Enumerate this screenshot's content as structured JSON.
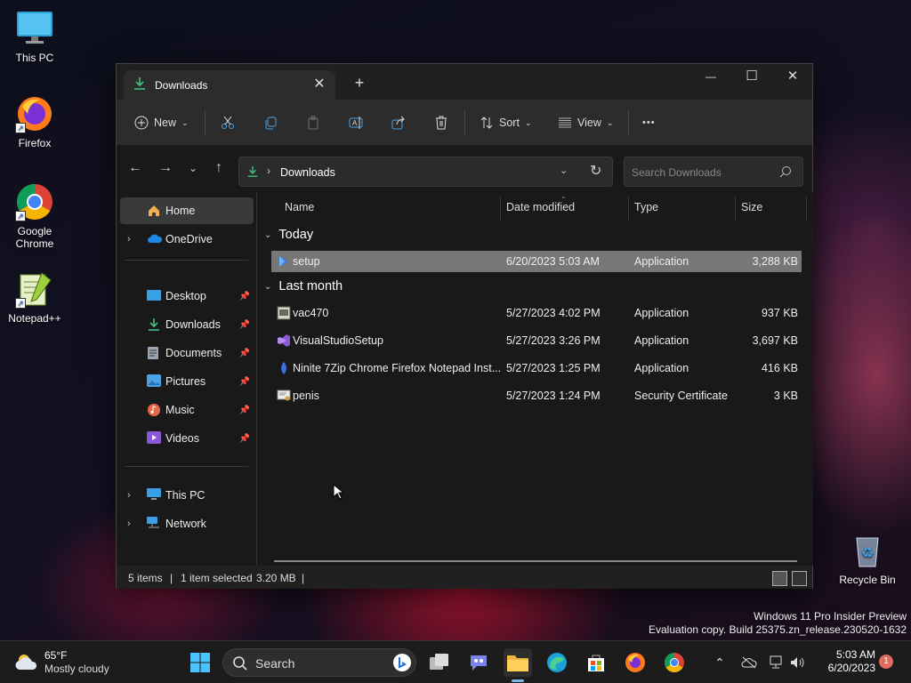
{
  "desktop": {
    "icons": [
      {
        "label": "This PC"
      },
      {
        "label": "Firefox"
      },
      {
        "label": "Google Chrome"
      },
      {
        "label": "Notepad++"
      },
      {
        "label": "Recycle Bin"
      }
    ],
    "watermark": {
      "line1": "Windows 11 Pro Insider Preview",
      "line2": "Evaluation copy. Build 25375.zn_release.230520-1632"
    }
  },
  "window": {
    "tab_title": "Downloads",
    "new_tab": "+",
    "controls": {
      "minimize": "—",
      "maximize": "☐",
      "close": "✕"
    },
    "toolbar": {
      "new_label": "New",
      "sort_label": "Sort",
      "view_label": "View",
      "more_label": "•••"
    },
    "address": {
      "path": "Downloads",
      "separator": "›"
    },
    "search": {
      "placeholder": "Search Downloads"
    },
    "sidebar": {
      "home": "Home",
      "onedrive": "OneDrive",
      "pinned": [
        "Desktop",
        "Downloads",
        "Documents",
        "Pictures",
        "Music",
        "Videos"
      ],
      "this_pc": "This PC",
      "network": "Network"
    },
    "columns": {
      "name": "Name",
      "date": "Date modified",
      "type": "Type",
      "size": "Size"
    },
    "groups": {
      "today": "Today",
      "last_month": "Last month"
    },
    "files_today": [
      {
        "name": "setup",
        "date": "6/20/2023 5:03 AM",
        "type": "Application",
        "size": "3,288 KB",
        "selected": true,
        "icon": "setup-icon"
      }
    ],
    "files_last_month": [
      {
        "name": "vac470",
        "date": "5/27/2023 4:02 PM",
        "type": "Application",
        "size": "937 KB",
        "icon": "app-icon"
      },
      {
        "name": "VisualStudioSetup",
        "date": "5/27/2023 3:26 PM",
        "type": "Application",
        "size": "3,697 KB",
        "icon": "visual-studio-icon"
      },
      {
        "name": "Ninite 7Zip Chrome Firefox Notepad Inst...",
        "date": "5/27/2023 1:25 PM",
        "type": "Application",
        "size": "416 KB",
        "icon": "ninite-icon"
      },
      {
        "name": "penis",
        "date": "5/27/2023 1:24 PM",
        "type": "Security Certificate",
        "size": "3 KB",
        "icon": "certificate-icon"
      }
    ],
    "status": {
      "items": "5 items",
      "selected": "1 item selected",
      "size": "3.20 MB"
    }
  },
  "taskbar": {
    "weather": {
      "temp": "65°F",
      "desc": "Mostly cloudy"
    },
    "search_label": "Search",
    "clock": {
      "time": "5:03 AM",
      "date": "6/20/2023"
    },
    "notification_count": "1"
  },
  "colors": {
    "accent": "#77b6e8",
    "selection": "#777777",
    "window_bg": "#191919"
  }
}
